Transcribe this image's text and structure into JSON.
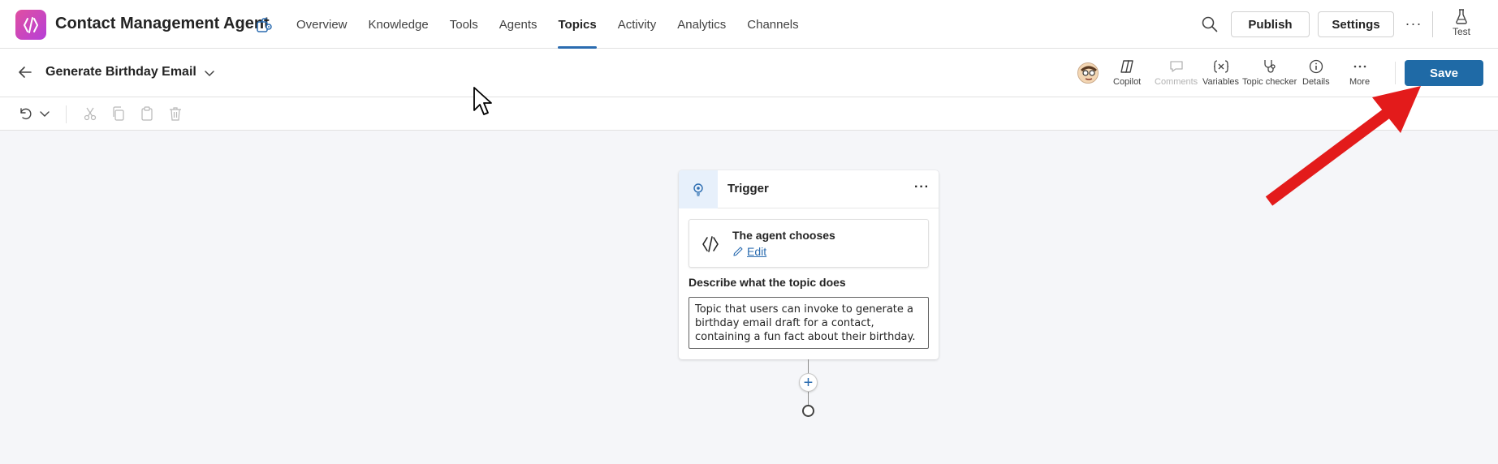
{
  "app": {
    "title": "Contact Management Agent",
    "accent_color": "#2b6cb0",
    "logo_gradient": [
      "#e04fa1",
      "#b63fd8"
    ]
  },
  "nav": {
    "tabs": [
      "Overview",
      "Knowledge",
      "Tools",
      "Agents",
      "Topics",
      "Activity",
      "Analytics",
      "Channels"
    ],
    "active_tab": "Topics"
  },
  "top_actions": {
    "publish_label": "Publish",
    "settings_label": "Settings",
    "more_label": "···",
    "test_label": "Test"
  },
  "topic": {
    "title": "Generate Birthday Email"
  },
  "topic_tools": {
    "copilot": "Copilot",
    "comments": "Comments",
    "variables": "Variables",
    "topic_checker": "Topic checker",
    "details": "Details",
    "more": "More",
    "save": "Save"
  },
  "trigger": {
    "label": "Trigger",
    "more": "···",
    "chooser_title": "The agent chooses",
    "edit_label": "Edit",
    "describe_label": "Describe what the topic does",
    "describe_text": "Topic that users can invoke to generate a birthday email draft for a contact, containing a fun fact about their birthday."
  },
  "flow": {
    "add_node_symbol": "+"
  },
  "annotation": {
    "arrow_color": "#e31b1b"
  }
}
